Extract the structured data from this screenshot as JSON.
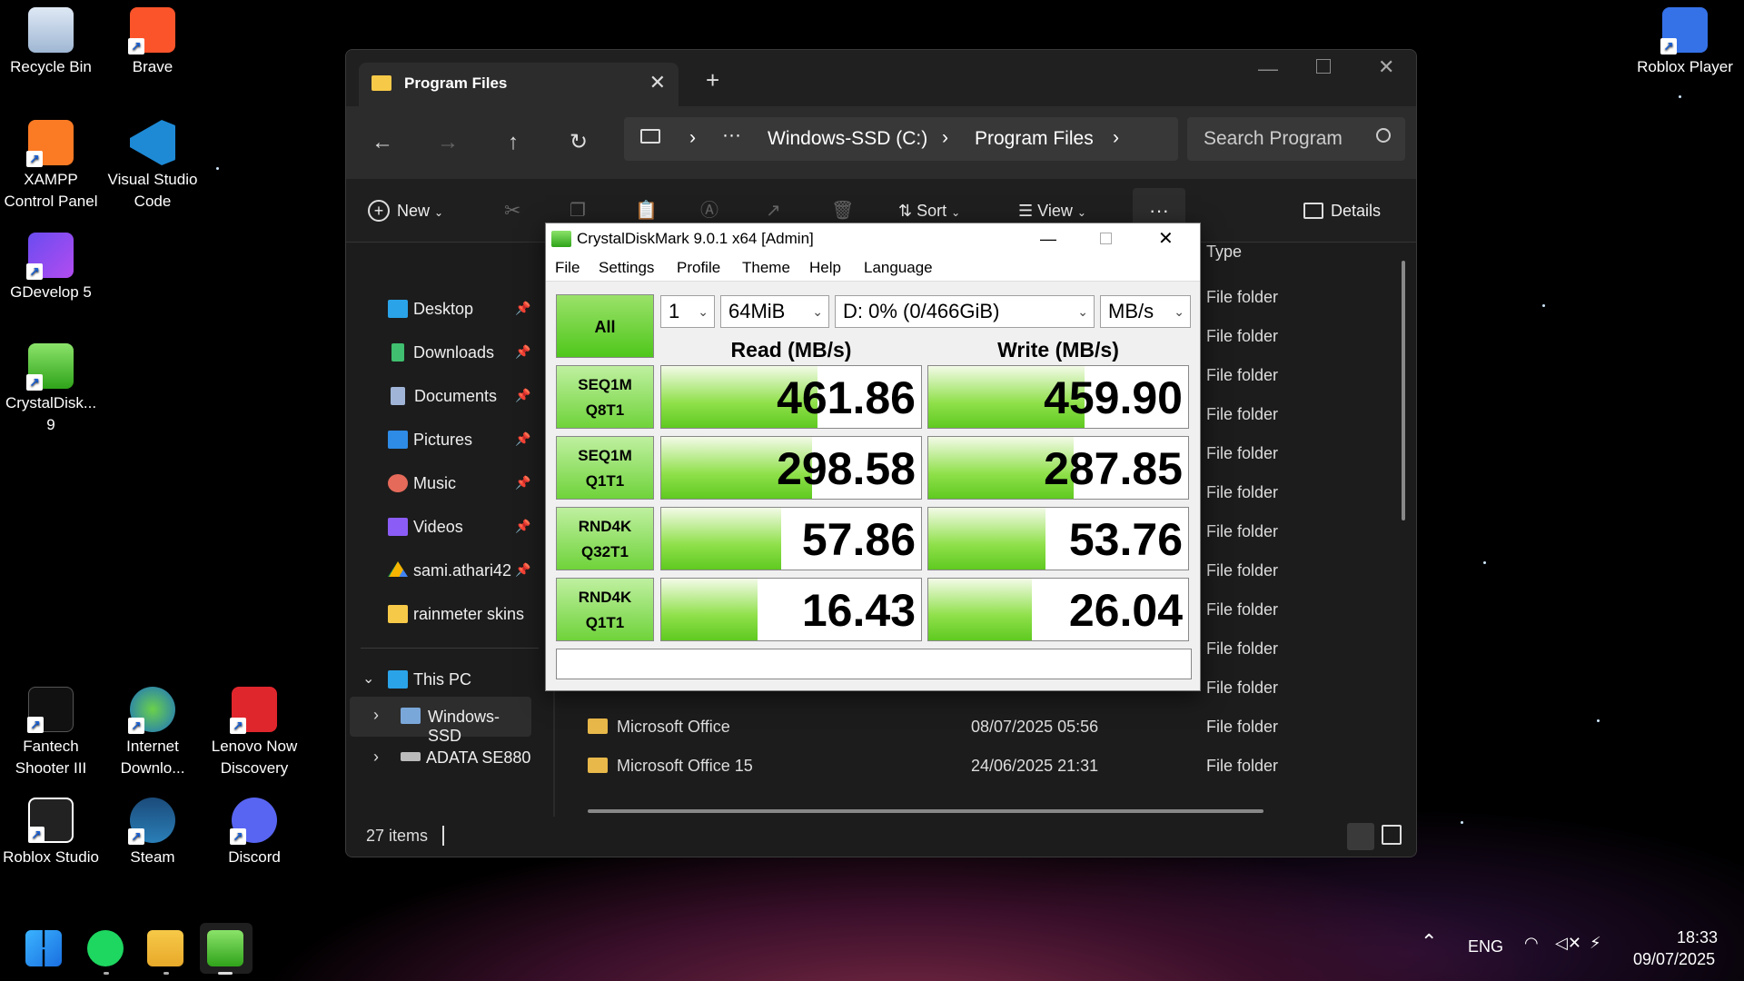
{
  "desktop": {
    "left_icons": [
      {
        "label": "Recycle Bin",
        "icon": "recycle-bin-icon"
      },
      {
        "label": "Brave",
        "icon": "brave-icon"
      },
      {
        "label": "XAMPP Control Panel",
        "icon": "xampp-icon"
      },
      {
        "label": "Visual Studio Code",
        "icon": "vscode-icon"
      },
      {
        "label": "GDevelop 5",
        "icon": "gdevelop-icon"
      },
      {
        "label": "CrystalDisk... 9",
        "icon": "crystaldisk-icon"
      },
      {
        "label": "Fantech Shooter III",
        "icon": "fantech-icon"
      },
      {
        "label": "Internet Downlo...",
        "icon": "idm-icon"
      },
      {
        "label": "Lenovo Now Discovery",
        "icon": "lenovo-icon"
      },
      {
        "label": "Roblox Studio",
        "icon": "roblox-studio-icon"
      },
      {
        "label": "Steam",
        "icon": "steam-icon"
      },
      {
        "label": "Discord",
        "icon": "discord-icon"
      }
    ],
    "right_icons": [
      {
        "label": "Roblox Player",
        "icon": "roblox-player-icon"
      }
    ]
  },
  "explorer": {
    "tab_title": "Program Files",
    "address": {
      "segment1": "Windows-SSD (C:)",
      "segment2": "Program Files",
      "more": "···"
    },
    "search_placeholder": "Search Program",
    "toolbar": {
      "new": "New",
      "sort": "Sort",
      "view": "View",
      "more": "···",
      "details": "Details"
    },
    "sidebar": {
      "quick": [
        {
          "label": "Desktop",
          "color": "#2aa3e8"
        },
        {
          "label": "Downloads",
          "color": "#3fbf6f"
        },
        {
          "label": "Documents",
          "color": "#9fb4d6"
        },
        {
          "label": "Pictures",
          "color": "#2e8be6"
        },
        {
          "label": "Music",
          "color": "#e56a5a"
        },
        {
          "label": "Videos",
          "color": "#8b5cf6"
        },
        {
          "label": "sami.athari42",
          "color": "#f4b400"
        },
        {
          "label": "rainmeter skins",
          "color": "#f7c948"
        }
      ],
      "this_pc": "This PC",
      "drives": [
        "Windows-SSD",
        "ADATA SE880"
      ]
    },
    "columns": {
      "type": "Type"
    },
    "type_values": [
      "File folder",
      "File folder",
      "File folder",
      "File folder",
      "File folder",
      "File folder",
      "File folder",
      "File folder",
      "File folder",
      "File folder",
      "File folder",
      "File folder",
      "File folder"
    ],
    "visible_rows": [
      {
        "name": "Microsoft Office",
        "date": "08/07/2025 05:56",
        "type": "File folder"
      },
      {
        "name": "Microsoft Office 15",
        "date": "24/06/2025 21:31",
        "type": "File folder"
      }
    ],
    "status": "27 items"
  },
  "cdm": {
    "title": "CrystalDiskMark 9.0.1 x64 [Admin]",
    "menu": [
      "File",
      "Settings",
      "Profile",
      "Theme",
      "Help",
      "Language"
    ],
    "count": "1",
    "size": "64MiB",
    "drive": "D: 0% (0/466GiB)",
    "unit": "MB/s",
    "all_label": "All",
    "read_header": "Read (MB/s)",
    "write_header": "Write (MB/s)",
    "tests": [
      {
        "line1": "SEQ1M",
        "line2": "Q8T1",
        "read": "461.86",
        "write": "459.90",
        "read_frac": 0.6,
        "write_frac": 0.6
      },
      {
        "line1": "SEQ1M",
        "line2": "Q1T1",
        "read": "298.58",
        "write": "287.85",
        "read_frac": 0.58,
        "write_frac": 0.56
      },
      {
        "line1": "RND4K",
        "line2": "Q32T1",
        "read": "57.86",
        "write": "53.76",
        "read_frac": 0.46,
        "write_frac": 0.45
      },
      {
        "line1": "RND4K",
        "line2": "Q1T1",
        "read": "16.43",
        "write": "26.04",
        "read_frac": 0.37,
        "write_frac": 0.4
      }
    ]
  },
  "taskbar": {
    "lang": "ENG",
    "time": "18:33",
    "date": "09/07/2025"
  }
}
